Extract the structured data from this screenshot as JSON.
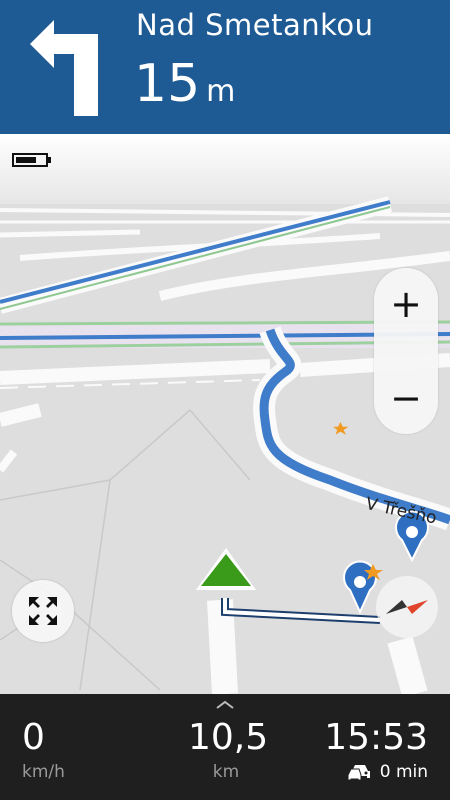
{
  "banner": {
    "turn": "turn-left",
    "street": "Nad Smetankou",
    "distance": "15",
    "distance_unit": "m",
    "color": "#1e5a94"
  },
  "map": {
    "street_label": "V Třešňo",
    "route_color": "#3f7cc9",
    "position_marker_color": "#3a9a1a"
  },
  "controls": {
    "zoom_in": "+",
    "zoom_out": "−"
  },
  "bottom": {
    "speed": "0",
    "speed_unit": "km/h",
    "distance": "10,5",
    "distance_unit": "km",
    "arrival_time": "15:53",
    "traffic_delay": "0 min"
  }
}
